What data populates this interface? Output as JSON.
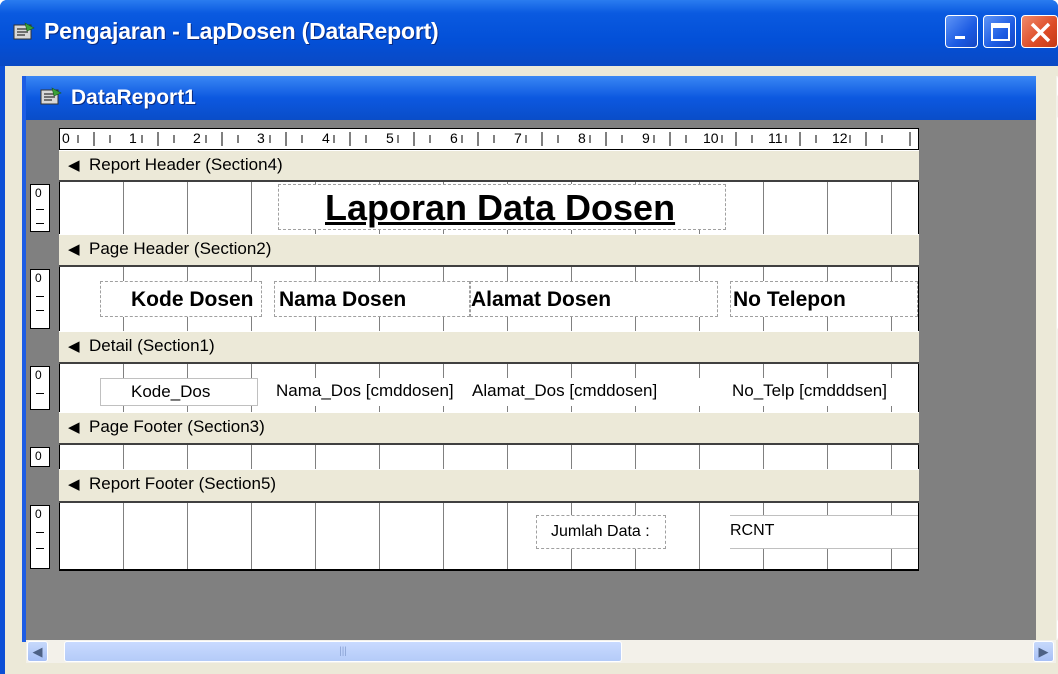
{
  "window": {
    "title": "Pengajaran - LapDosen (DataReport)"
  },
  "child": {
    "title": "DataReport1"
  },
  "ruler": {
    "h_labels": [
      "0",
      "1",
      "2",
      "3",
      "4",
      "5",
      "6",
      "7",
      "8",
      "9",
      "10",
      "11",
      "12"
    ],
    "v_zero": "0"
  },
  "sections": {
    "report_header": "Report Header (Section4)",
    "page_header": "Page Header (Section2)",
    "detail": "Detail (Section1)",
    "page_footer": "Page Footer (Section3)",
    "report_footer": "Report Footer (Section5)"
  },
  "report_header": {
    "title": "Laporan Data Dosen"
  },
  "page_header": {
    "kode": "Kode Dosen",
    "nama": "Nama Dosen",
    "alamat": "Alamat Dosen",
    "telp": "No Telepon"
  },
  "detail": {
    "kode": "Kode_Dos",
    "nama": "Nama_Dos [cmddosen]",
    "alamat": "Alamat_Dos [cmddosen]",
    "telp": "No_Telp [cmdddsen]"
  },
  "report_footer": {
    "jumlah_label": "Jumlah Data :",
    "rcnt": "RCNT"
  },
  "icons": {
    "window_icon": "datareport-icon",
    "section_arrow": "section-arrow-icon"
  }
}
